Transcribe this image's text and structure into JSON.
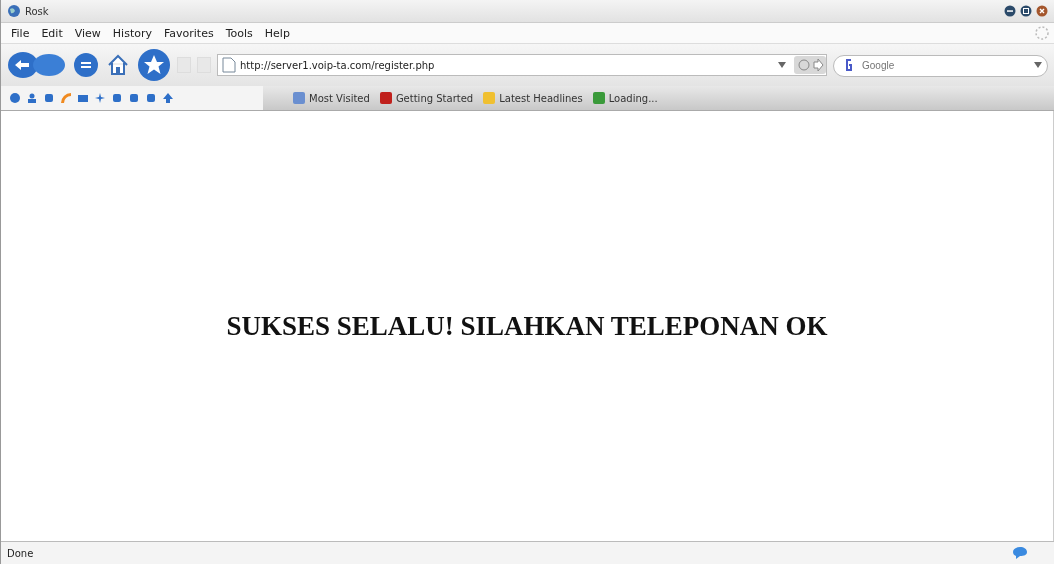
{
  "window": {
    "title": "Rosk"
  },
  "menu": [
    {
      "label": "File"
    },
    {
      "label": "Edit"
    },
    {
      "label": "View"
    },
    {
      "label": "History"
    },
    {
      "label": "Favorites"
    },
    {
      "label": "Tools"
    },
    {
      "label": "Help"
    }
  ],
  "address": {
    "value": "http://server1.voip-ta.com/register.php"
  },
  "search": {
    "placeholder": "Google"
  },
  "bookmarks": [
    {
      "label": "Most Visited",
      "color": "#6a8fd0"
    },
    {
      "label": "Getting Started",
      "color": "#c0201c"
    },
    {
      "label": "Latest Headlines",
      "color": "#f0c030"
    },
    {
      "label": "Loading...",
      "color": "#3a9a3a"
    }
  ],
  "page": {
    "heading": "SUKSES SELALU! SILAHKAN TELEPONAN OK"
  },
  "status_bar": {
    "text": "Done"
  }
}
